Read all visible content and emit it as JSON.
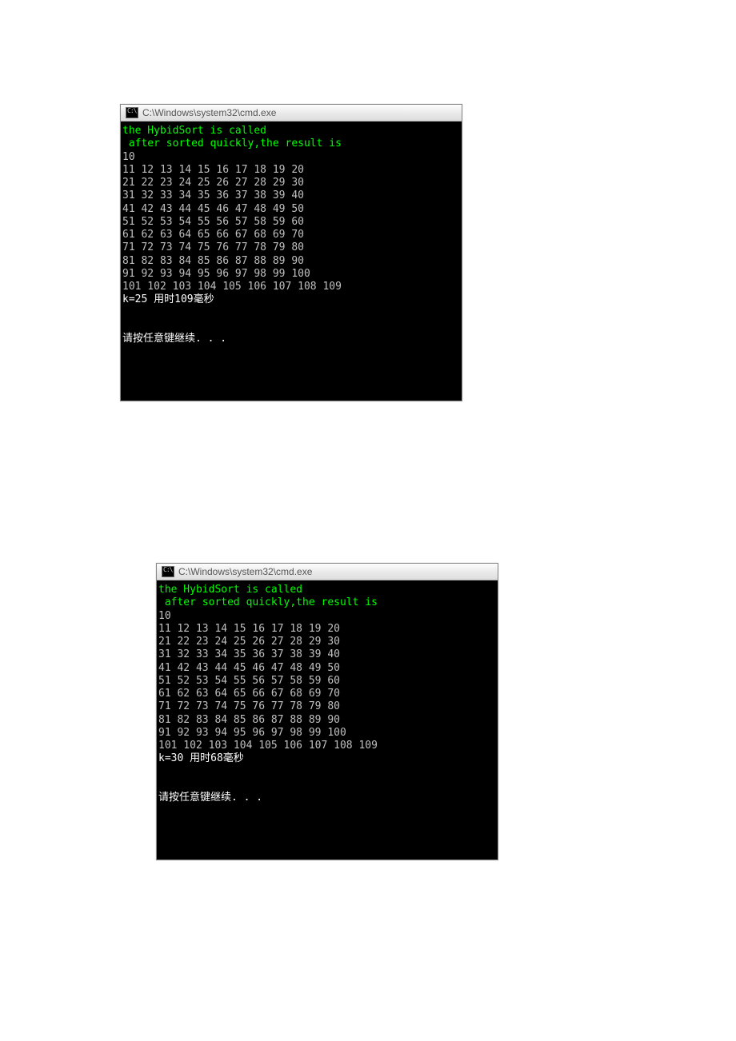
{
  "windows": [
    {
      "title": "C:\\Windows\\system32\\cmd.exe",
      "lines": [
        {
          "cls": "green-text",
          "text": "the HybidSort is called"
        },
        {
          "cls": "green-text",
          "text": " after sorted quickly,the result is"
        },
        {
          "cls": "gray-text",
          "text": "10"
        },
        {
          "cls": "gray-text",
          "text": "11 12 13 14 15 16 17 18 19 20"
        },
        {
          "cls": "gray-text",
          "text": "21 22 23 24 25 26 27 28 29 30"
        },
        {
          "cls": "gray-text",
          "text": "31 32 33 34 35 36 37 38 39 40"
        },
        {
          "cls": "gray-text",
          "text": "41 42 43 44 45 46 47 48 49 50"
        },
        {
          "cls": "gray-text",
          "text": "51 52 53 54 55 56 57 58 59 60"
        },
        {
          "cls": "gray-text",
          "text": "61 62 63 64 65 66 67 68 69 70"
        },
        {
          "cls": "gray-text",
          "text": "71 72 73 74 75 76 77 78 79 80"
        },
        {
          "cls": "gray-text",
          "text": "81 82 83 84 85 86 87 88 89 90"
        },
        {
          "cls": "gray-text",
          "text": "91 92 93 94 95 96 97 98 99 100"
        },
        {
          "cls": "gray-text",
          "text": "101 102 103 104 105 106 107 108 109"
        },
        {
          "cls": "white-text",
          "text": "k=25 用时109毫秒"
        },
        {
          "cls": "blank",
          "text": ""
        },
        {
          "cls": "blank",
          "text": ""
        },
        {
          "cls": "white-text",
          "text": "请按任意键继续. . ."
        },
        {
          "cls": "blank",
          "text": ""
        },
        {
          "cls": "blank",
          "text": ""
        },
        {
          "cls": "blank",
          "text": ""
        },
        {
          "cls": "blank",
          "text": ""
        }
      ]
    },
    {
      "title": "C:\\Windows\\system32\\cmd.exe",
      "lines": [
        {
          "cls": "green-text",
          "text": "the HybidSort is called"
        },
        {
          "cls": "green-text",
          "text": " after sorted quickly,the result is"
        },
        {
          "cls": "gray-text",
          "text": "10"
        },
        {
          "cls": "gray-text",
          "text": "11 12 13 14 15 16 17 18 19 20"
        },
        {
          "cls": "gray-text",
          "text": "21 22 23 24 25 26 27 28 29 30"
        },
        {
          "cls": "gray-text",
          "text": "31 32 33 34 35 36 37 38 39 40"
        },
        {
          "cls": "gray-text",
          "text": "41 42 43 44 45 46 47 48 49 50"
        },
        {
          "cls": "gray-text",
          "text": "51 52 53 54 55 56 57 58 59 60"
        },
        {
          "cls": "gray-text",
          "text": "61 62 63 64 65 66 67 68 69 70"
        },
        {
          "cls": "gray-text",
          "text": "71 72 73 74 75 76 77 78 79 80"
        },
        {
          "cls": "gray-text",
          "text": "81 82 83 84 85 86 87 88 89 90"
        },
        {
          "cls": "gray-text",
          "text": "91 92 93 94 95 96 97 98 99 100"
        },
        {
          "cls": "gray-text",
          "text": "101 102 103 104 105 106 107 108 109"
        },
        {
          "cls": "white-text",
          "text": "k=30 用时68毫秒"
        },
        {
          "cls": "blank",
          "text": ""
        },
        {
          "cls": "blank",
          "text": ""
        },
        {
          "cls": "white-text",
          "text": "请按任意键继续. . ."
        },
        {
          "cls": "blank",
          "text": ""
        },
        {
          "cls": "blank",
          "text": ""
        },
        {
          "cls": "blank",
          "text": ""
        },
        {
          "cls": "blank",
          "text": ""
        }
      ]
    }
  ]
}
